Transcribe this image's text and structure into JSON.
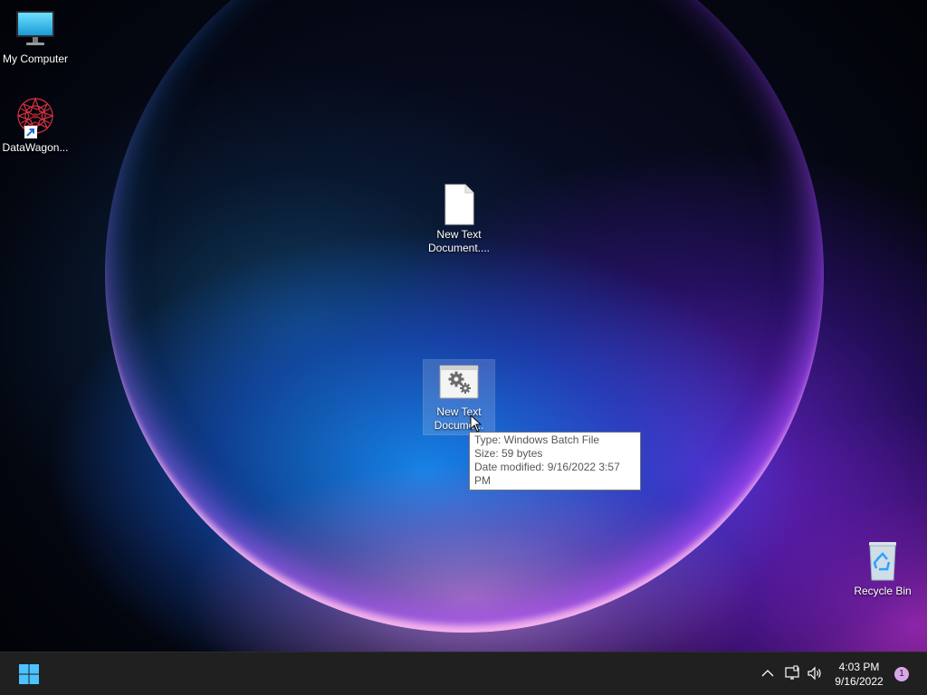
{
  "desktop": {
    "icons": [
      {
        "label": "My Computer",
        "icon": "monitor-icon"
      },
      {
        "label": "DataWagon...",
        "icon": "datawagon-shortcut-icon"
      },
      {
        "label": "New Text Document....",
        "icon": "text-file-icon"
      },
      {
        "label": "New Text Docume...",
        "icon": "batch-file-icon"
      },
      {
        "label": "Recycle Bin",
        "icon": "recycle-bin-icon"
      }
    ],
    "tooltip": {
      "type_line": "Type: Windows Batch File",
      "size_line": "Size: 59 bytes",
      "modified_line": "Date modified: 9/16/2022 3:57 PM"
    }
  },
  "taskbar": {
    "start_icon": "windows-logo-icon",
    "tray_icons": [
      "chevron-up-icon",
      "network-icon",
      "volume-icon"
    ],
    "time": "4:03 PM",
    "date": "9/16/2022",
    "notification_count": "1"
  },
  "colors": {
    "taskbar": "#202020",
    "start_blue": "#4cc2ff",
    "tooltip_bg": "#ffffff",
    "badge": "#d9a6e8"
  }
}
